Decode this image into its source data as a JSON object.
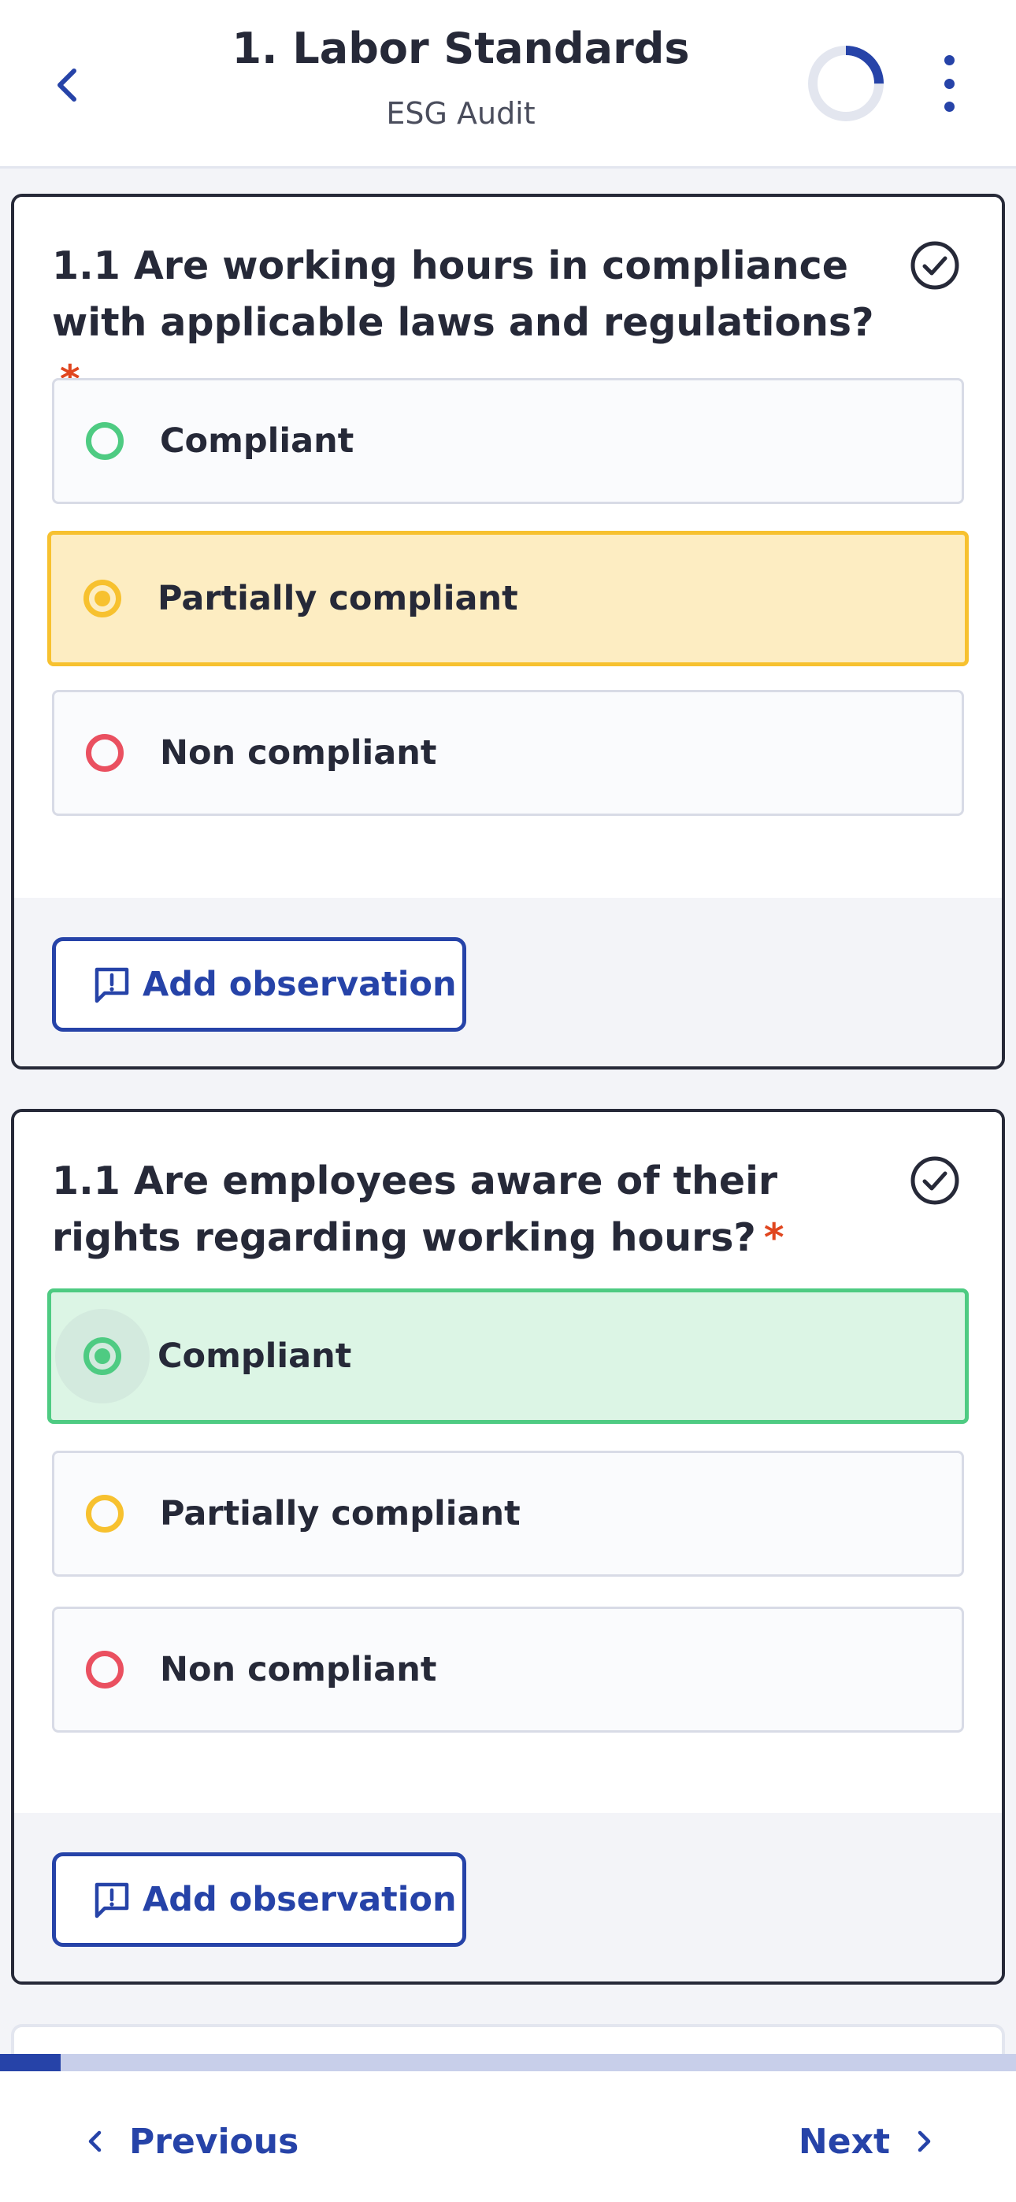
{
  "header": {
    "title": "1. Labor Standards",
    "subtitle": "ESG Audit",
    "progress_fraction": 0.25
  },
  "questions": [
    {
      "text": "1.1 Are working hours in compliance with applicable laws and regulations?",
      "required_mark": "*",
      "selected": "Partially compliant",
      "options": [
        {
          "label": "Compliant",
          "color": "#4ecb82"
        },
        {
          "label": "Partially compliant",
          "color": "#f7c12f"
        },
        {
          "label": "Non compliant",
          "color": "#ea5060"
        }
      ],
      "observation_label": "Add observation"
    },
    {
      "text": "1.1 Are employees aware of their rights regarding working hours?",
      "required_mark": "*",
      "selected": "Compliant",
      "options": [
        {
          "label": "Compliant",
          "color": "#4ecb82"
        },
        {
          "label": "Partially compliant",
          "color": "#f7c12f"
        },
        {
          "label": "Non compliant",
          "color": "#ea5060"
        }
      ],
      "observation_label": "Add observation"
    }
  ],
  "page_progress_fraction": 0.06,
  "nav": {
    "previous_label": "Previous",
    "next_label": "Next"
  },
  "colors": {
    "accent": "#2643a8",
    "compliant": "#4ecb82",
    "partial": "#f7c12f",
    "noncompliant": "#ea5060",
    "required": "#e0461f"
  }
}
